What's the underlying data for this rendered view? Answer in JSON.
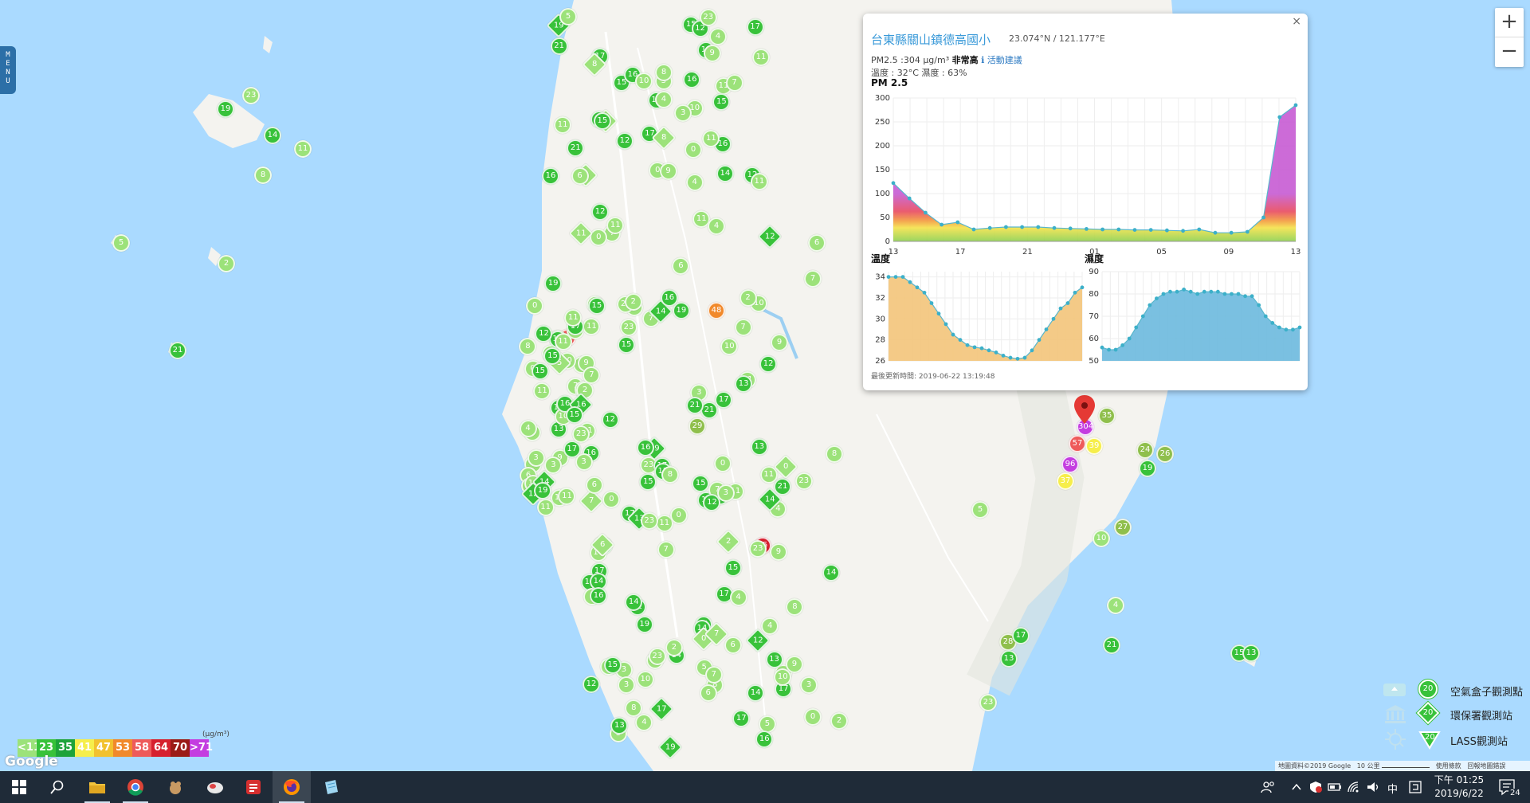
{
  "menu": {
    "label": "MENU"
  },
  "zoom": {
    "in_label": "+",
    "out_label": "−"
  },
  "popup": {
    "close_label": "×",
    "station_name": "台東縣關山鎮德高國小",
    "coordinates": "23.074°N / 121.177°E",
    "pm_reading": "PM2.5 :304 μg/m³",
    "pm_status": "非常高",
    "advice_link": "活動建議",
    "environment": "溫度 : 32°C 濕度 : 63%",
    "pm_chart_title": "PM 2.5",
    "temp_chart_title": "溫度",
    "humidity_chart_title": "濕度",
    "updated": "最後更新時間: 2019-06-22 13:19:48"
  },
  "chart_data": [
    {
      "type": "area",
      "title": "PM 2.5",
      "x": [
        "13",
        "",
        "",
        "",
        "17",
        "",
        "",
        "",
        "21",
        "",
        "",
        "",
        "01",
        "",
        "",
        "",
        "05",
        "",
        "",
        "",
        "09",
        "",
        "",
        "",
        "13"
      ],
      "tick_labels": [
        "13",
        "17",
        "21",
        "01",
        "05",
        "09",
        "13"
      ],
      "yticks": [
        0,
        50,
        100,
        150,
        200,
        250,
        300
      ],
      "ylim": [
        0,
        300
      ],
      "values": [
        122,
        90,
        60,
        35,
        40,
        25,
        28,
        30,
        30,
        30,
        28,
        27,
        26,
        25,
        25,
        24,
        24,
        23,
        22,
        25,
        18,
        18,
        20,
        50,
        260,
        285
      ],
      "fill_gradient": [
        "#8fd14f",
        "#f4e24a",
        "#f39c3d",
        "#e84a5f",
        "#c65bd3"
      ],
      "point_color": "#3cb0c9"
    },
    {
      "type": "area",
      "title": "溫度",
      "yticks": [
        26,
        28,
        30,
        32,
        34
      ],
      "ylim": [
        26,
        34.5
      ],
      "values": [
        34,
        34,
        34,
        33.5,
        33,
        32.5,
        31.5,
        30.5,
        29.5,
        28.5,
        28,
        27.5,
        27.3,
        27.2,
        27,
        26.8,
        26.5,
        26.3,
        26.2,
        26.3,
        27,
        28,
        29,
        30,
        31,
        31.5,
        32.5,
        33
      ],
      "fill_color": "#f3c47a",
      "point_color": "#3cb0c9"
    },
    {
      "type": "area",
      "title": "濕度",
      "yticks": [
        50,
        60,
        70,
        80,
        90
      ],
      "ylim": [
        50,
        90
      ],
      "values": [
        56,
        55,
        55,
        57,
        60,
        65,
        70,
        75,
        78,
        80,
        81,
        81,
        82,
        81,
        80,
        81,
        81,
        81,
        80,
        80,
        80,
        79,
        79,
        75,
        70,
        67,
        65,
        64,
        64,
        65
      ],
      "fill_color": "#6bb9de",
      "point_color": "#3cb0c9"
    }
  ],
  "legend": {
    "unit": "(μg/m³)",
    "bins": [
      {
        "label": "<11",
        "color": "#9ce27a"
      },
      {
        "label": "23",
        "color": "#38c23a"
      },
      {
        "label": "35",
        "color": "#1ea33a"
      },
      {
        "label": "41",
        "color": "#f6ee4b"
      },
      {
        "label": "47",
        "color": "#f2c12e"
      },
      {
        "label": "53",
        "color": "#f1892b"
      },
      {
        "label": "58",
        "color": "#ee5a5a"
      },
      {
        "label": "64",
        "color": "#d6202e"
      },
      {
        "label": "70",
        "color": "#9b1b17"
      },
      {
        "label": ">71",
        "color": "#c43de0"
      }
    ]
  },
  "symbol_legend": [
    {
      "label": "空氣盒子觀測點",
      "value": "20",
      "icon": "airbox-icon"
    },
    {
      "label": "環保署觀測站",
      "value": "20",
      "icon": "government-building-icon"
    },
    {
      "label": "LASS觀測站",
      "value": "20",
      "icon": "lass-sensor-icon"
    }
  ],
  "google_logo": "Google",
  "attribution": {
    "data": "地圖資料©2019 Google",
    "scale": "10 公里",
    "terms": "使用條款",
    "report": "回報地圖錯誤"
  },
  "taskbar": {
    "apps": [
      {
        "name": "start-button",
        "icon": "windows-icon"
      },
      {
        "name": "search-button",
        "icon": "search-icon"
      },
      {
        "name": "file-explorer",
        "icon": "folder-icon"
      },
      {
        "name": "chrome",
        "icon": "chrome-icon"
      },
      {
        "name": "app-squirrel",
        "icon": "squirrel-icon"
      },
      {
        "name": "app-bird",
        "icon": "bird-icon"
      },
      {
        "name": "app-red",
        "icon": "red-app-icon"
      },
      {
        "name": "firefox",
        "icon": "firefox-icon"
      },
      {
        "name": "app-notes",
        "icon": "notes-icon"
      }
    ],
    "ime": "中",
    "time": "下午 01:25",
    "date": "2019/6/22",
    "notifications": "24"
  },
  "markers": [
    {
      "v": "59",
      "c": "#ee5a5a"
    },
    {
      "v": "48",
      "c": "#f1892b"
    },
    {
      "v": "65",
      "c": "#d6202e"
    },
    {
      "v": "304",
      "c": "#c43de0"
    },
    {
      "v": "96",
      "c": "#c43de0"
    },
    {
      "v": "57",
      "c": "#ee5a5a"
    },
    {
      "v": "39",
      "c": "#f6ee4b"
    },
    {
      "v": "37",
      "c": "#f6ee4b"
    },
    {
      "v": "29",
      "c": "#8fbf4c"
    },
    {
      "v": "26",
      "c": "#8fbf4c"
    },
    {
      "v": "24",
      "c": "#8fbf4c"
    },
    {
      "v": "27",
      "c": "#8fbf4c"
    },
    {
      "v": "35",
      "c": "#8fbf4c"
    },
    {
      "v": "28",
      "c": "#8fbf4c"
    },
    {
      "v": "23",
      "c": "#9ce27a"
    },
    {
      "v": "21",
      "c": "#38c23a"
    },
    {
      "v": "17",
      "c": "#38c23a"
    },
    {
      "v": "19",
      "c": "#38c23a"
    },
    {
      "v": "15",
      "c": "#38c23a"
    },
    {
      "v": "16",
      "c": "#38c23a"
    },
    {
      "v": "14",
      "c": "#38c23a"
    },
    {
      "v": "13",
      "c": "#38c23a"
    },
    {
      "v": "12",
      "c": "#38c23a"
    },
    {
      "v": "11",
      "c": "#9ce27a"
    },
    {
      "v": "10",
      "c": "#9ce27a"
    },
    {
      "v": "9",
      "c": "#9ce27a"
    },
    {
      "v": "8",
      "c": "#9ce27a"
    },
    {
      "v": "7",
      "c": "#9ce27a"
    },
    {
      "v": "6",
      "c": "#9ce27a"
    },
    {
      "v": "5",
      "c": "#9ce27a"
    },
    {
      "v": "4",
      "c": "#9ce27a"
    },
    {
      "v": "3",
      "c": "#9ce27a"
    },
    {
      "v": "2",
      "c": "#9ce27a"
    },
    {
      "v": "0",
      "c": "#9ce27a"
    }
  ]
}
